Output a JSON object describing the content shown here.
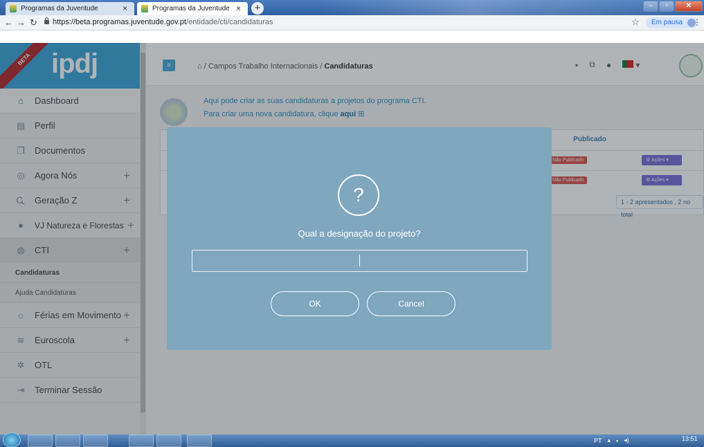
{
  "browser": {
    "tabs": [
      {
        "label": "Programas da Juventude"
      },
      {
        "label": "Programas da Juventude"
      }
    ],
    "new_tab_label": "+",
    "close_tab_label": "×",
    "url_host": "https://beta.programas.juventude.gov.pt",
    "url_path": "/entidade/cti/candidaturas",
    "profile_label": "Em pausa"
  },
  "sidebar": {
    "logo": "ipdj",
    "beta_label": "BETA",
    "items": [
      {
        "label": "Dashboard",
        "icon": "home-icon"
      },
      {
        "label": "Perfil",
        "icon": "id-card-icon"
      },
      {
        "label": "Documentos",
        "icon": "documents-icon"
      },
      {
        "label": "Agora Nós",
        "icon": "agora-nos-icon",
        "plus": "+"
      },
      {
        "label": "Geração Z",
        "icon": "geracao-z-icon",
        "plus": "+"
      },
      {
        "label": "VJ Natureza e Florestas",
        "icon": "leaf-icon",
        "plus": "+"
      },
      {
        "label": "CTI",
        "icon": "globe-icon",
        "plus": "+"
      },
      {
        "label": "Férias em Movimento",
        "icon": "ferias-icon",
        "plus": "+"
      },
      {
        "label": "Euroscola",
        "icon": "euroscola-icon",
        "plus": "+"
      },
      {
        "label": "OTL",
        "icon": "otl-icon"
      },
      {
        "label": "Terminar Sessão",
        "icon": "logout-icon"
      }
    ],
    "sub_items": [
      {
        "label": "Candidaturas"
      },
      {
        "label": "Ajuda Candidaturas"
      }
    ]
  },
  "header": {
    "breadcrumb_prefix": "/ Campos Trabalho Internacionais /",
    "breadcrumb_current": "Candidaturas"
  },
  "info": {
    "line1": "Aqui pode criar as suas candidaturas a projetos do programa CTI.",
    "line2_prefix": "Para criar uma nova candidatura, clique",
    "line2_link": "aqui"
  },
  "table": {
    "col_publicado": "Publicado",
    "rows": [
      {
        "publicado": "Não Publicado",
        "actions": "Ações"
      },
      {
        "publicado": "Não Publicado",
        "actions": "Ações"
      }
    ],
    "pager": "1 - 2 apresentados , 2 no total"
  },
  "modal": {
    "icon": "?",
    "title": "Qual a designação do projeto?",
    "input_value": "",
    "ok_label": "OK",
    "cancel_label": "Cancel"
  },
  "taskbar": {
    "lang": "PT",
    "time": "13:51"
  }
}
